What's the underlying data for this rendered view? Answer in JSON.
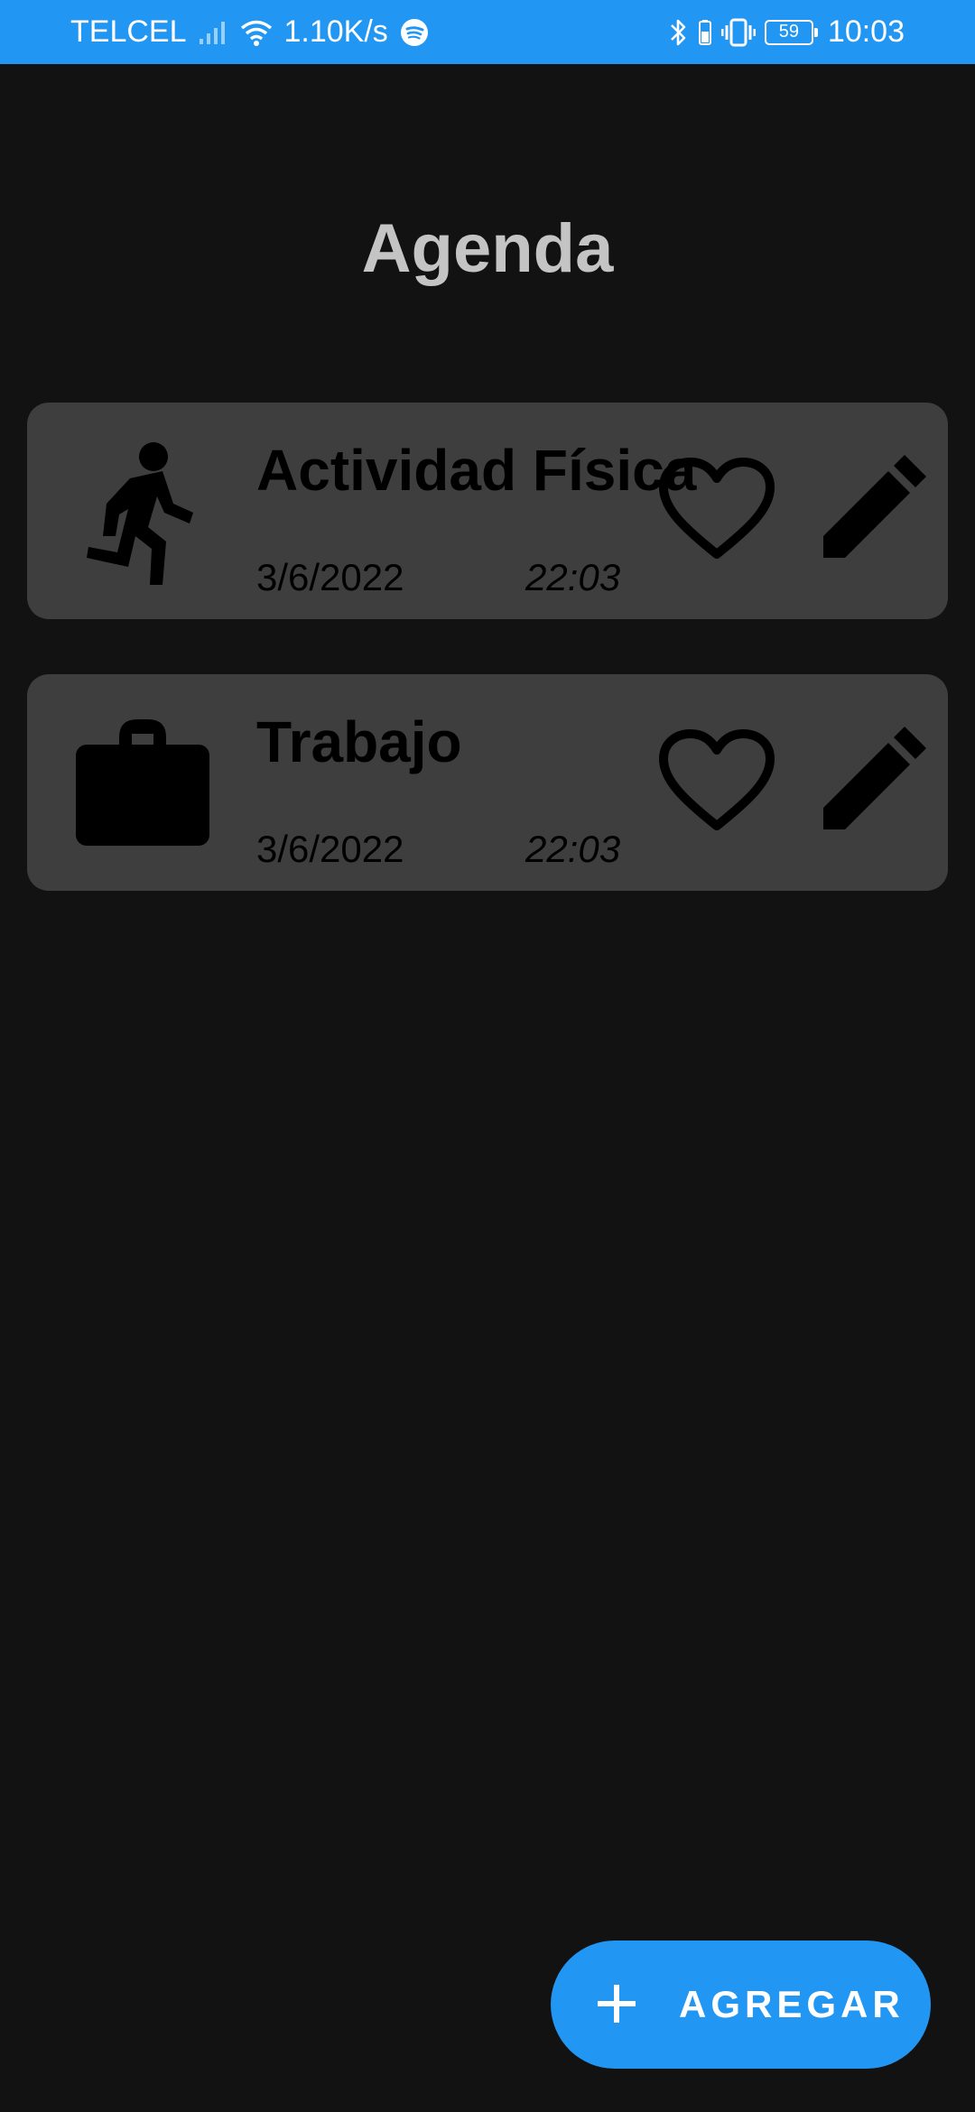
{
  "status_bar": {
    "carrier": "TELCEL",
    "net_speed": "1.10K/s",
    "battery_level": "59",
    "time": "10:03",
    "icons": [
      "signal-icon",
      "wifi-icon",
      "spotify-icon",
      "bluetooth-icon",
      "vibrate-icon",
      "battery-icon"
    ]
  },
  "page": {
    "title": "Agenda"
  },
  "items": [
    {
      "title": "Actividad Física",
      "date": "3/6/2022",
      "time": "22:03",
      "icon": "running-person-icon"
    },
    {
      "title": "Trabajo",
      "date": "3/6/2022",
      "time": "22:03",
      "icon": "briefcase-icon"
    }
  ],
  "fab": {
    "label": "AGREGAR",
    "icon": "plus-icon"
  },
  "colors": {
    "accent": "#2196F3",
    "background": "#121212",
    "card": "#3e3e3e",
    "title_text": "#c4c4c4"
  }
}
